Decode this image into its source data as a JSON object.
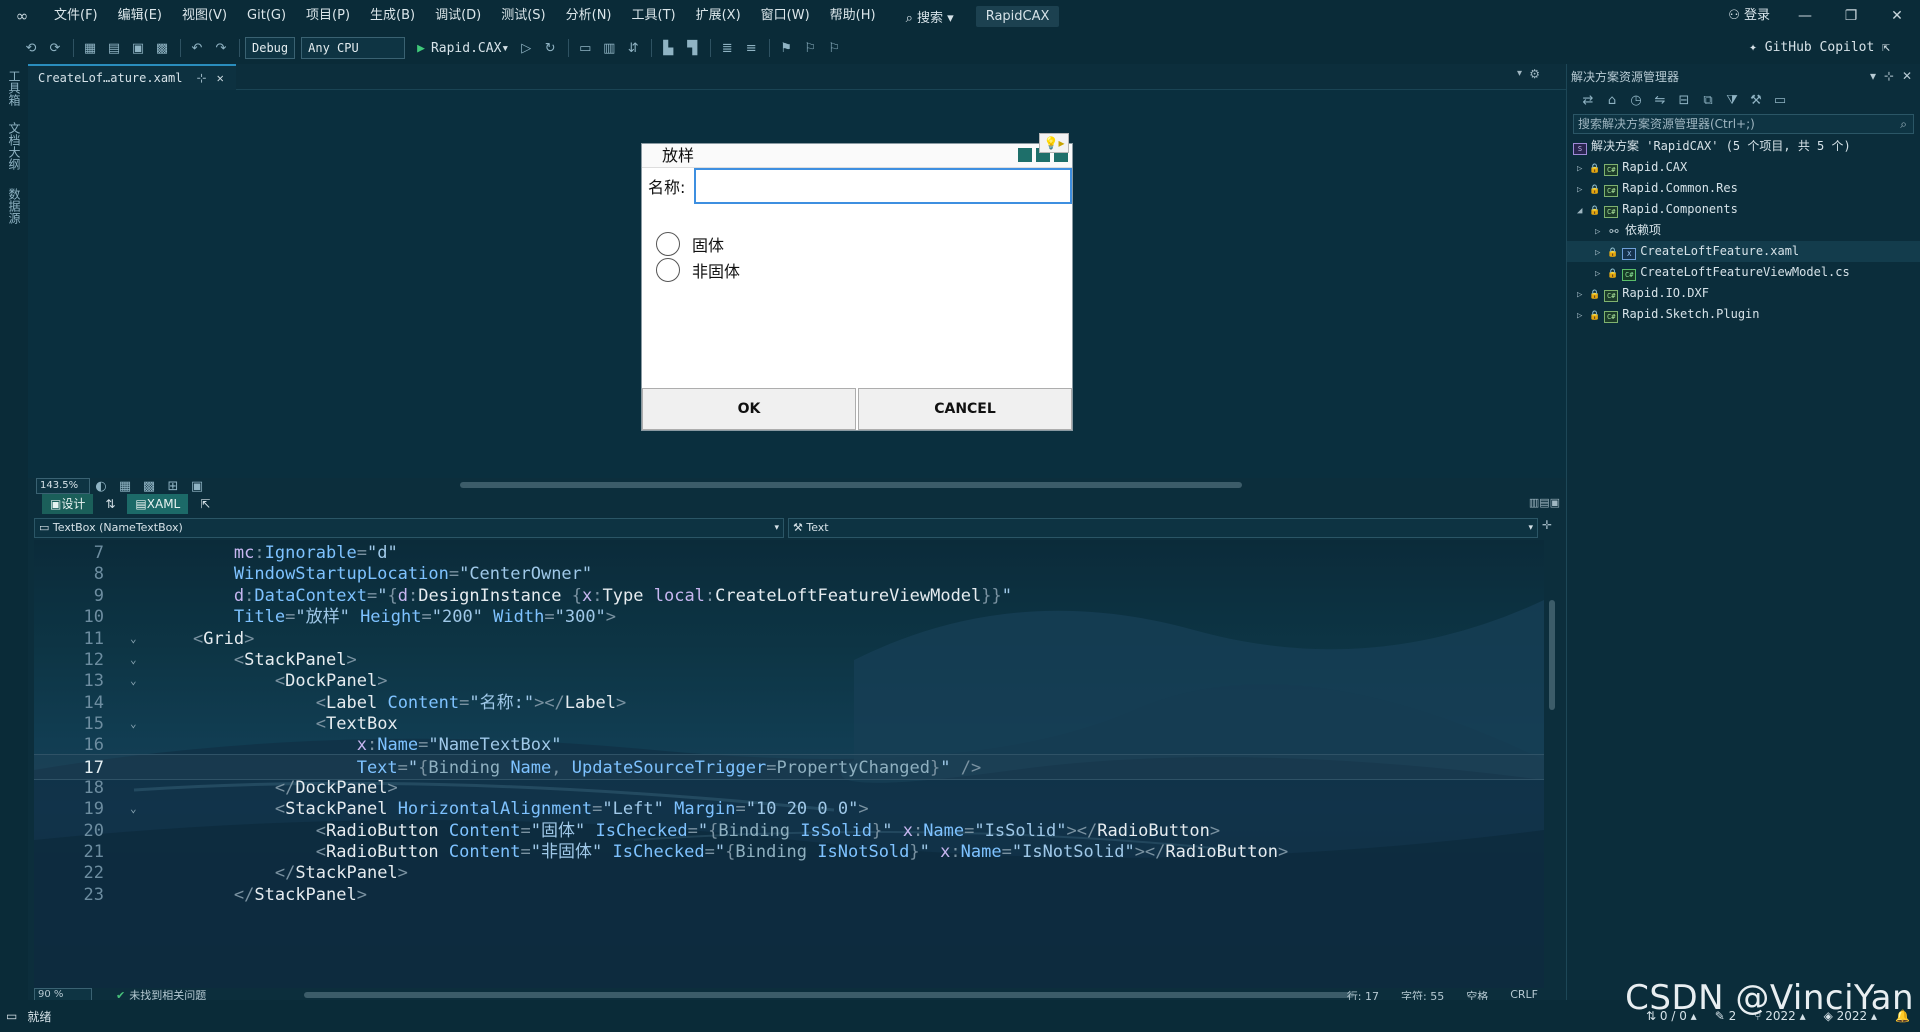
{
  "menubar": {
    "items": [
      "文件(F)",
      "编辑(E)",
      "视图(V)",
      "Git(G)",
      "项目(P)",
      "生成(B)",
      "调试(D)",
      "测试(S)",
      "分析(N)",
      "工具(T)",
      "扩展(X)",
      "窗口(W)",
      "帮助(H)"
    ],
    "search_label": "搜索",
    "solution_badge": "RapidCAX",
    "login_label": "登录"
  },
  "toolbar": {
    "config": "Debug",
    "platform": "Any CPU",
    "run_target": "Rapid.CAX",
    "copilot_label": "GitHub Copilot"
  },
  "left_rail": {
    "labels": [
      "工具箱",
      "文档大纲",
      "数据源"
    ]
  },
  "doc_tab": {
    "title": "CreateLof…ature.xaml"
  },
  "designer": {
    "zoom": "143.5%",
    "window_title": "放样",
    "name_label": "名称:",
    "radio1": "固体",
    "radio2": "非固体",
    "ok_label": "OK",
    "cancel_label": "CANCEL"
  },
  "view_tabs": {
    "design": "设计",
    "xaml": "XAML"
  },
  "nav": {
    "element": "TextBox (NameTextBox)",
    "property": "Text"
  },
  "code": {
    "current_line": 17,
    "lines": [
      {
        "n": "7"
      },
      {
        "n": "8"
      },
      {
        "n": "9"
      },
      {
        "n": "10"
      },
      {
        "n": "11"
      },
      {
        "n": "12"
      },
      {
        "n": "13"
      },
      {
        "n": "14"
      },
      {
        "n": "15"
      },
      {
        "n": "16"
      },
      {
        "n": "17"
      },
      {
        "n": "18"
      },
      {
        "n": "19"
      },
      {
        "n": "20"
      },
      {
        "n": "21"
      },
      {
        "n": "22"
      },
      {
        "n": "23"
      }
    ]
  },
  "editor_status": {
    "zoom": "90 %",
    "issues": "未找到相关问题",
    "line": "行: 17",
    "char": "字符: 55",
    "spaces": "空格",
    "eol": "CRLF"
  },
  "solution_explorer": {
    "title": "解决方案资源管理器",
    "search_placeholder": "搜索解决方案资源管理器(Ctrl+;)",
    "items": [
      {
        "label": "解决方案 'RapidCAX' (5 个项目, 共 5 个)"
      },
      {
        "label": "Rapid.CAX"
      },
      {
        "label": "Rapid.Common.Res"
      },
      {
        "label": "Rapid.Components"
      },
      {
        "label": "依赖项"
      },
      {
        "label": "CreateLoftFeature.xaml"
      },
      {
        "label": "CreateLoftFeatureViewModel.cs"
      },
      {
        "label": "Rapid.IO.DXF"
      },
      {
        "label": "Rapid.Sketch.Plugin"
      }
    ]
  },
  "statusbar": {
    "ready": "就绪",
    "errors": "0 / 0",
    "pencil": "2",
    "branch": "2022",
    "repo": "2022"
  },
  "watermark": "CSDN @VinciYan",
  "colors": {
    "accent": "#2a8dbd",
    "background": "#0c2e3c",
    "ok_green": "#47c27b"
  }
}
